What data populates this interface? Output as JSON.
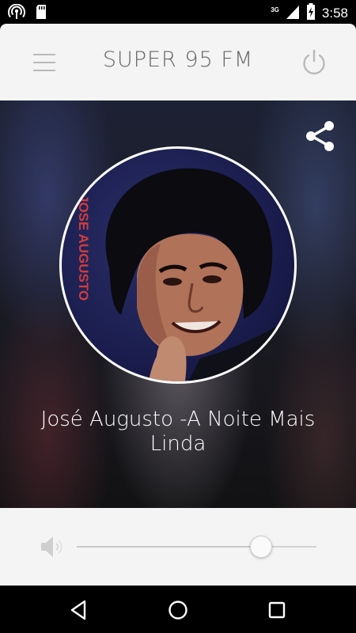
{
  "status_bar": {
    "time": "3:58",
    "network": "3G",
    "icons": [
      "wifi-hotspot-icon",
      "sd-card-icon",
      "signal-icon",
      "battery-charging-icon"
    ]
  },
  "header": {
    "title": "SUPER 95 FM",
    "menu_icon": "hamburger-menu-icon",
    "power_icon": "power-icon",
    "colors": {
      "background": "#f4f4f4",
      "title": "#666666",
      "icon": "#b9b9b9"
    }
  },
  "player": {
    "share_icon": "share-icon",
    "artwork_text": "JOSE AUGUSTO",
    "now_playing": "José Augusto -A Noite Mais Linda"
  },
  "volume": {
    "icon": "volume-icon",
    "level": 0.77
  },
  "nav_bar": {
    "icons": [
      "back-icon",
      "home-icon",
      "recents-icon"
    ]
  }
}
